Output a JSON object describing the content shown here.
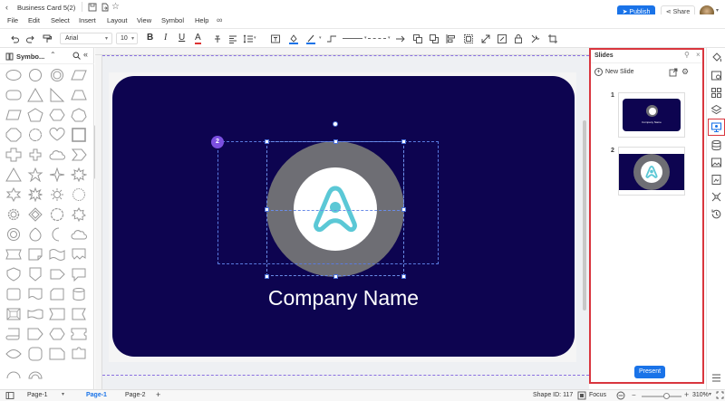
{
  "app": {
    "doc_title": "Business Card 5(2)",
    "publish_label": "Publish",
    "share_label": "Share"
  },
  "menu": [
    "File",
    "Edit",
    "Select",
    "Insert",
    "Layout",
    "View",
    "Symbol",
    "Help"
  ],
  "toolbar": {
    "font_family": "Arial",
    "font_size": "10"
  },
  "symbols_panel": {
    "title": "Symbo..."
  },
  "canvas": {
    "card_text": "Company Name",
    "selection_badge": "2",
    "card_bg": "#0d0450",
    "ring_color": "#6e6e74",
    "logo_color": "#5bc8d6"
  },
  "slides": {
    "title": "Slides",
    "new_slide_label": "New Slide",
    "items": [
      {
        "number": "1",
        "caption": "Company Name"
      },
      {
        "number": "2",
        "caption": ""
      }
    ],
    "present_label": "Present"
  },
  "status": {
    "page_selector": "Page-1",
    "tabs": [
      "Page-1",
      "Page-2"
    ],
    "shape_id": "Shape ID: 117",
    "focus_label": "Focus",
    "zoom": "310%"
  },
  "colors": {
    "accent": "#1a73e8",
    "highlight_border": "#d9363e",
    "badge": "#7b4fe0"
  }
}
